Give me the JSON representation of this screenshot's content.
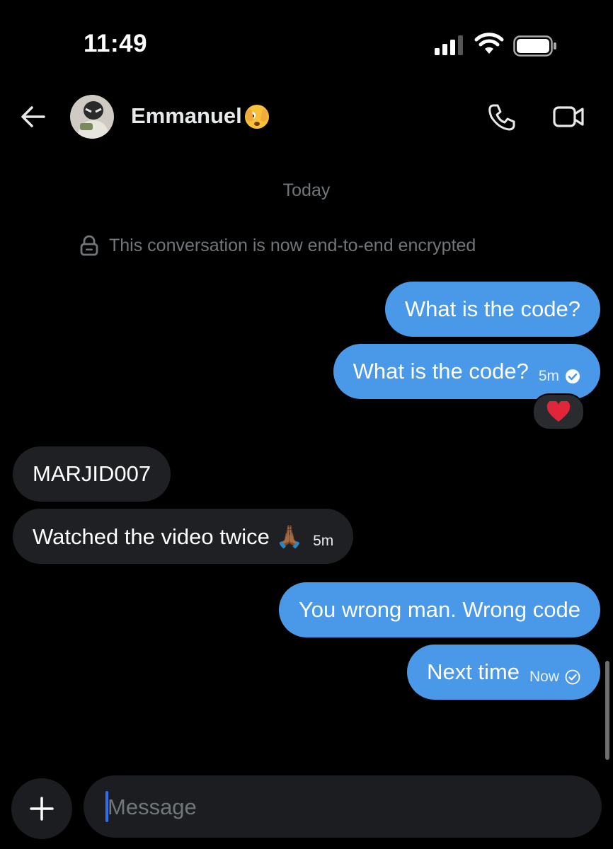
{
  "status_bar": {
    "time": "11:49"
  },
  "header": {
    "contact_name": "Emmanuel",
    "name_emoji": "🫣"
  },
  "thread": {
    "date_label": "Today",
    "encryption_notice": "This conversation is now end-to-end encrypted",
    "messages": [
      {
        "direction": "outgoing",
        "text": "What is the code?"
      },
      {
        "direction": "outgoing",
        "text": "What is the code?",
        "time": "5m",
        "reaction": "❤️"
      },
      {
        "direction": "incoming",
        "text": "MARJID007"
      },
      {
        "direction": "incoming",
        "text": "Watched the video twice 🙏🏾",
        "time": "5m"
      },
      {
        "direction": "outgoing",
        "text": "You wrong man. Wrong code"
      },
      {
        "direction": "outgoing",
        "text": "Next time",
        "time": "Now"
      }
    ]
  },
  "composer": {
    "placeholder": "Message"
  },
  "colors": {
    "outgoing_bubble": "#4a99e9",
    "incoming_bubble": "#1f2023",
    "background": "#000000"
  }
}
